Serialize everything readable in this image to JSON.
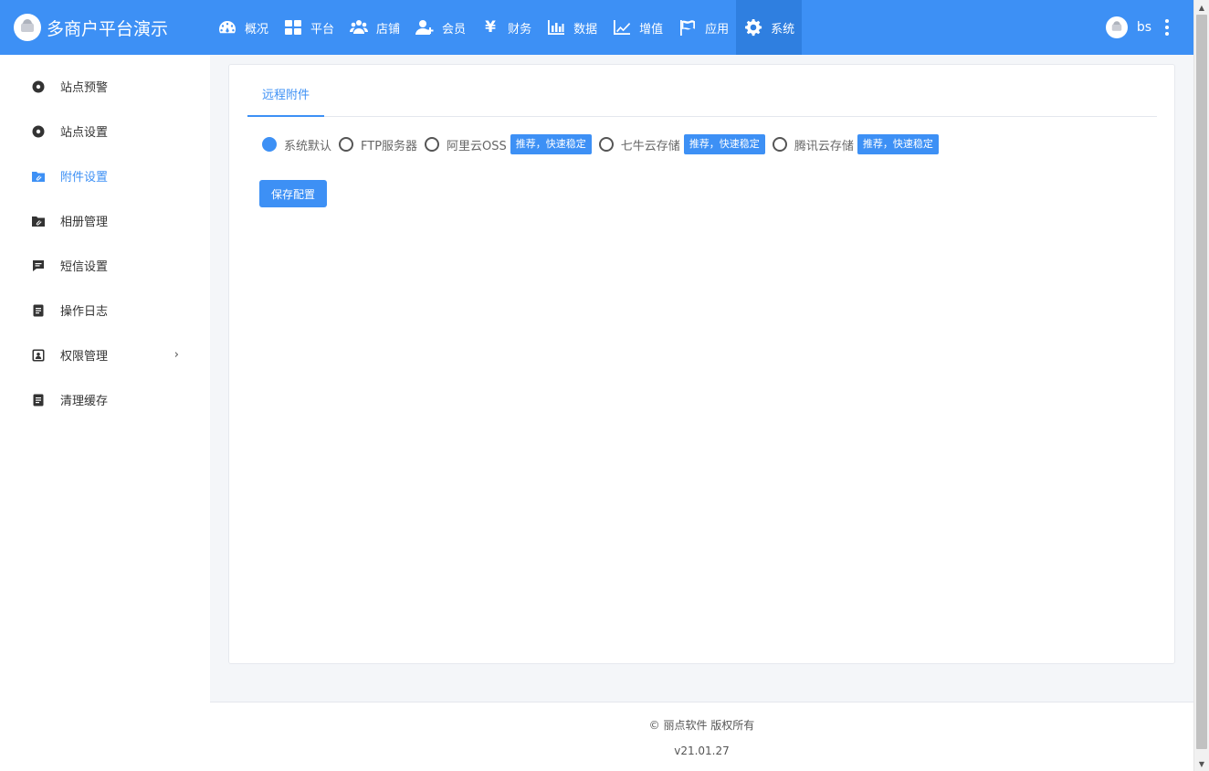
{
  "brand": {
    "title": "多商户平台演示"
  },
  "nav": [
    {
      "label": "概况",
      "icon": "dashboard-icon"
    },
    {
      "label": "平台",
      "icon": "grid-icon"
    },
    {
      "label": "店铺",
      "icon": "users-icon"
    },
    {
      "label": "会员",
      "icon": "user-plus-icon"
    },
    {
      "label": "财务",
      "icon": "yen-icon"
    },
    {
      "label": "数据",
      "icon": "bar-chart-icon"
    },
    {
      "label": "增值",
      "icon": "line-chart-icon"
    },
    {
      "label": "应用",
      "icon": "flag-icon"
    },
    {
      "label": "系统",
      "icon": "gear-icon",
      "active": true
    }
  ],
  "user": {
    "name": "bs"
  },
  "sidebar": {
    "items": [
      {
        "label": "站点预警",
        "icon": "gear-icon"
      },
      {
        "label": "站点设置",
        "icon": "gear-icon"
      },
      {
        "label": "附件设置",
        "icon": "folder-attachment-icon",
        "active": true
      },
      {
        "label": "相册管理",
        "icon": "folder-attachment-icon"
      },
      {
        "label": "短信设置",
        "icon": "message-icon"
      },
      {
        "label": "操作日志",
        "icon": "document-icon"
      },
      {
        "label": "权限管理",
        "icon": "user-card-icon",
        "has_children": true
      },
      {
        "label": "清理缓存",
        "icon": "document-icon"
      }
    ]
  },
  "main": {
    "tab": "远程附件",
    "options": [
      {
        "label": "系统默认",
        "checked": true,
        "badge": ""
      },
      {
        "label": "FTP服务器",
        "checked": false,
        "badge": ""
      },
      {
        "label": "阿里云OSS",
        "checked": false,
        "badge": "推荐，快速稳定"
      },
      {
        "label": "七牛云存储",
        "checked": false,
        "badge": "推荐，快速稳定"
      },
      {
        "label": "腾讯云存储",
        "checked": false,
        "badge": "推荐，快速稳定"
      }
    ],
    "save_label": "保存配置"
  },
  "footer": {
    "copyright": "© 丽点软件 版权所有",
    "version": "v21.01.27"
  },
  "colors": {
    "primary": "#3d90f5",
    "active_nav": "#2f7fe0"
  }
}
